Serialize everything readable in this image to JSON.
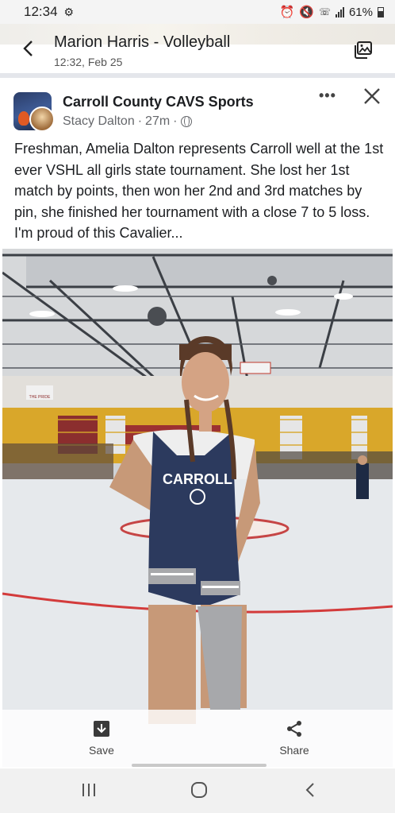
{
  "status_bar": {
    "time": "12:34",
    "battery": "61%",
    "icons": [
      "alarm-icon",
      "mute-icon",
      "wifi-call-icon",
      "signal-icon",
      "battery-icon"
    ]
  },
  "header": {
    "title": "Marion Harris - Volleyball",
    "subtitle": "12:32, Feb 25"
  },
  "post": {
    "page_name": "Carroll County CAVS Sports",
    "author": "Stacy Dalton",
    "time_ago": "27m",
    "separator": "·",
    "more": "•••",
    "text": "Freshman, Amelia Dalton represents Carroll well at the 1st ever VSHL all girls state tournament.  She lost her 1st match by points, then won her 2nd and 3rd matches by pin, she finished her tournament with a close 7 to 5 loss. I'm proud of this Cavalier...",
    "photo": {
      "singlet_text": "CARROLL",
      "banner_text": "THE PRIDE"
    }
  },
  "actions": {
    "save": "Save",
    "share": "Share"
  },
  "colors": {
    "singlet_navy": "#2c3a5e",
    "gym_yellow": "#d9a72a",
    "mat_red": "#d33b3b",
    "text_dark": "#1c1e21",
    "text_muted": "#65676b"
  }
}
